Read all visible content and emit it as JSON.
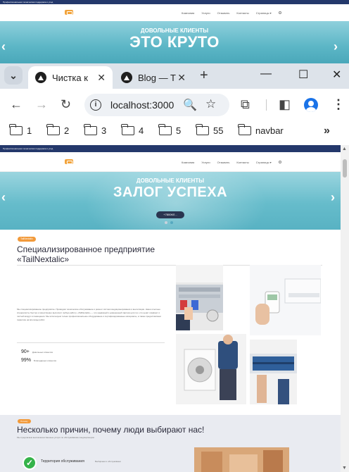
{
  "background_page": {
    "topbar_text": "Профессиональная техническая поддержка и уход",
    "menu": [
      "Компания",
      "Услуги",
      "Отзывать",
      "Контакты",
      "Страницы ▾"
    ],
    "hero_subtitle": "ДОВОЛЬНЫЕ КЛИЕНТЫ",
    "hero_title": "ЭТО КРУТО",
    "arrow_left": "‹",
    "arrow_right": "›"
  },
  "browser": {
    "tabs": [
      {
        "title": "Чистка к",
        "active": true
      },
      {
        "title": "Blog — T",
        "active": false
      }
    ],
    "tab_search_glyph": "⌄",
    "tab_close_glyph": "✕",
    "new_tab_glyph": "+",
    "window_buttons": {
      "minimize": "—",
      "maximize": "☐",
      "close": "✕"
    },
    "nav": {
      "back": "←",
      "forward": "→",
      "reload": "↻"
    },
    "address": "localhost:3000",
    "info_glyph": "i",
    "zoom_glyph": "🔍",
    "star_glyph": "☆",
    "extensions_glyph": "⧉",
    "sidepanel_glyph": "◧",
    "menu_glyph": "⋮",
    "bookmarks": [
      "1",
      "2",
      "3",
      "4",
      "5",
      "55",
      "navbar"
    ],
    "bookmarks_more": "»"
  },
  "page": {
    "topbar_text": "Профессиональная техническая поддержка и уход",
    "menu": [
      "Компания",
      "Услуги",
      "Отзывать",
      "Контакты",
      "Страницы ▾"
    ],
    "hero_subtitle": "ДОВОЛЬНЫЕ КЛИЕНТЫ",
    "hero_title": "ЗАЛОГ УСПЕХА",
    "hero_phone": "+7800КЛ...",
    "arrow_left": "‹",
    "arrow_right": "›",
    "about": {
      "badge": "TailNextalic",
      "title": "Специализированное предприятие «TailNextalic»",
      "text": "Мы специализированное предприятие. Проводим техническое обслуживание и ремонт систем кондиционирования и вентиляции. Наши опытные специалисты быстро и качественно выполнят любую работу. «TailNextalic» — это надёжный и доверенный партнёр для тех, кто ценит комфорт и чистый воздух в помещении. Мы используем только профессиональное оборудование и сертифицированные материалы, а также предоставляем гарантию на все виды работ.",
      "stats": [
        {
          "value": "90+",
          "label": "Довольных клиентов"
        },
        {
          "value": "99%",
          "label": "Благодарных клиентов"
        }
      ]
    },
    "why": {
      "badge": "Почему",
      "title": "Несколько причин, почему люди выбирают нас!",
      "subtitle": "Мы предлагаем высококачественные услуги по обслуживанию кондиционеров",
      "feature": "Территория обслуживания",
      "feature_note": "Выбираем и обслуживаем",
      "check_glyph": "✓"
    }
  },
  "colors": {
    "navy": "#24386b",
    "hero": "#5cb6c6",
    "accent": "#f29a3a",
    "check": "#35b34a"
  }
}
